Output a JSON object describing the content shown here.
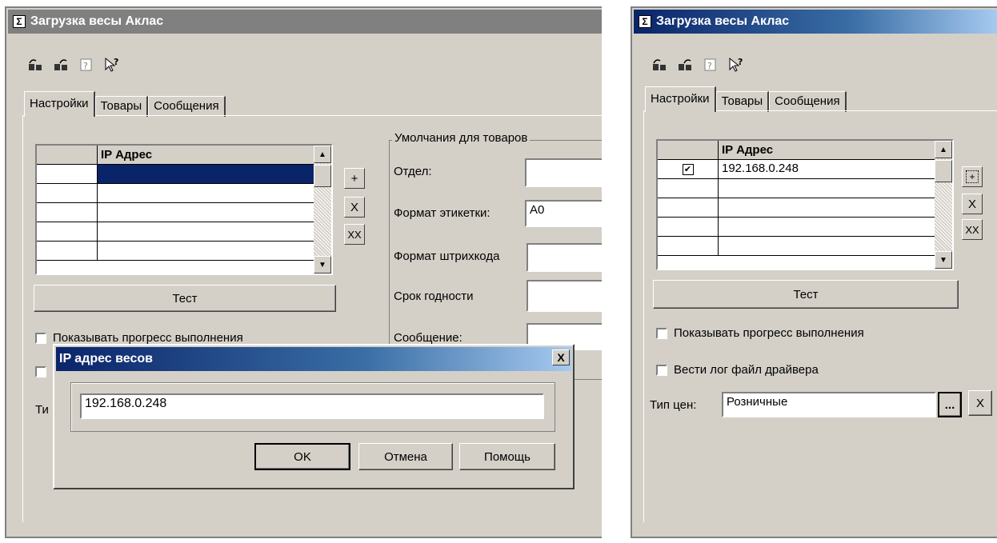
{
  "window": {
    "title": "Загрузка весы Аклас",
    "icon": "sigma-icon"
  },
  "toolbar": {
    "buttons": [
      "restore-icon",
      "save-icon",
      "help-icon",
      "whats-this-icon"
    ]
  },
  "tabs": [
    {
      "label": "Настройки",
      "active": true
    },
    {
      "label": "Товары",
      "active": false
    },
    {
      "label": "Сообщения",
      "active": false
    }
  ],
  "grid": {
    "column_ip": "IP Адрес",
    "left_rows": [
      "",
      "",
      "",
      "",
      ""
    ],
    "right_rows": [
      "192.168.0.248",
      "",
      "",
      "",
      ""
    ],
    "right_checked": [
      true,
      false,
      false,
      false,
      false
    ]
  },
  "row_buttons": {
    "add": "+",
    "delete": "X",
    "delete_all": "XX"
  },
  "test_button": "Тест",
  "checkboxes": {
    "show_progress": "Показывать прогресс выполнения",
    "driver_log": "Вести лог файл драйвера"
  },
  "price_type": {
    "label_left_partial": "Ти",
    "label": "Тип цен:",
    "value": "Розничные",
    "ellipsis": "...",
    "clear": "X"
  },
  "defaults": {
    "title": "Умолчания для товаров",
    "department": "Отдел:",
    "label_format": "Формат этикетки:",
    "label_format_value": "А0",
    "barcode_format": "Формат штрихкода",
    "shelf_life": "Срок годности",
    "message": "Сообщение:"
  },
  "dialog": {
    "title": "IP адрес весов",
    "close": "X",
    "ip_value": "192.168.0.248",
    "ok": "OK",
    "cancel": "Отмена",
    "help": "Помощь"
  }
}
